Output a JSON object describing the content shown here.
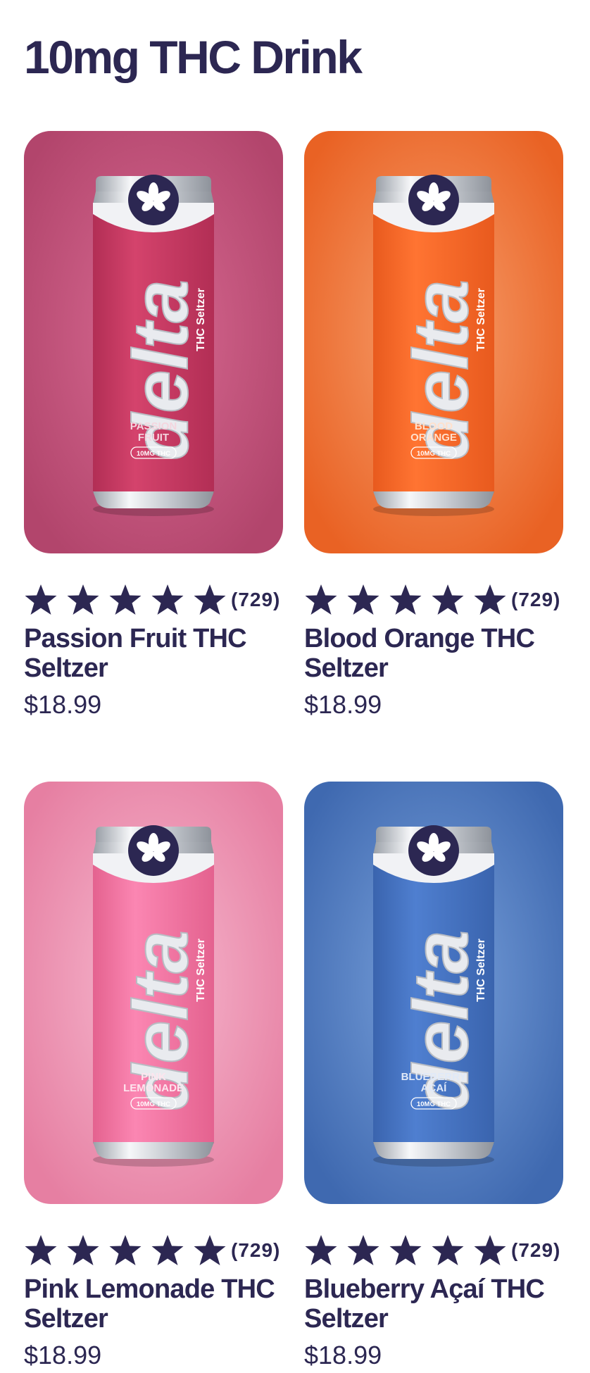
{
  "page": {
    "title": "10mg THC Drink"
  },
  "products": [
    {
      "name": "Passion Fruit THC Seltzer",
      "price": "$18.99",
      "rating_count": "(729)",
      "stars": 5,
      "can": {
        "brand": "delta",
        "tagline": "THC Seltzer",
        "flavor_line1": "PASSION",
        "flavor_line2": "FRUIT",
        "dose": "10MG THC"
      },
      "colors": {
        "bg_light": "#d86a92",
        "bg_dark": "#b2456c",
        "can_light": "#d4436c",
        "can_dark": "#b22e55",
        "flavor_text": "#f4d6df"
      }
    },
    {
      "name": "Blood Orange THC Seltzer",
      "price": "$18.99",
      "rating_count": "(729)",
      "stars": 5,
      "can": {
        "brand": "delta",
        "tagline": "THC Seltzer",
        "flavor_line1": "BLOOD",
        "flavor_line2": "ORANGE",
        "dose": "10MG THC"
      },
      "colors": {
        "bg_light": "#f7a06e",
        "bg_dark": "#e96224",
        "can_light": "#ff7432",
        "can_dark": "#e85a1e",
        "flavor_text": "#ffe1cd"
      }
    },
    {
      "name": "Pink Lemonade THC Seltzer",
      "price": "$18.99",
      "rating_count": "(729)",
      "stars": 5,
      "can": {
        "brand": "delta",
        "tagline": "THC Seltzer",
        "flavor_line1": "PINK",
        "flavor_line2": "LEMONADE",
        "dose": "10MG THC"
      },
      "colors": {
        "bg_light": "#f7bad0",
        "bg_dark": "#e67fa2",
        "can_light": "#fb86b2",
        "can_dark": "#e4628f",
        "flavor_text": "#fde5ee"
      }
    },
    {
      "name": "Blueberry Açaí THC Seltzer",
      "price": "$18.99",
      "rating_count": "(729)",
      "stars": 5,
      "can": {
        "brand": "delta",
        "tagline": "THC Seltzer",
        "flavor_line1": "BLUEBERRY",
        "flavor_line2": "AÇAÍ",
        "dose": "10MG THC"
      },
      "colors": {
        "bg_light": "#7aa2dc",
        "bg_dark": "#3f69b0",
        "can_light": "#4f7fd0",
        "can_dark": "#3a64ae",
        "flavor_text": "#e0e9f8"
      }
    }
  ]
}
